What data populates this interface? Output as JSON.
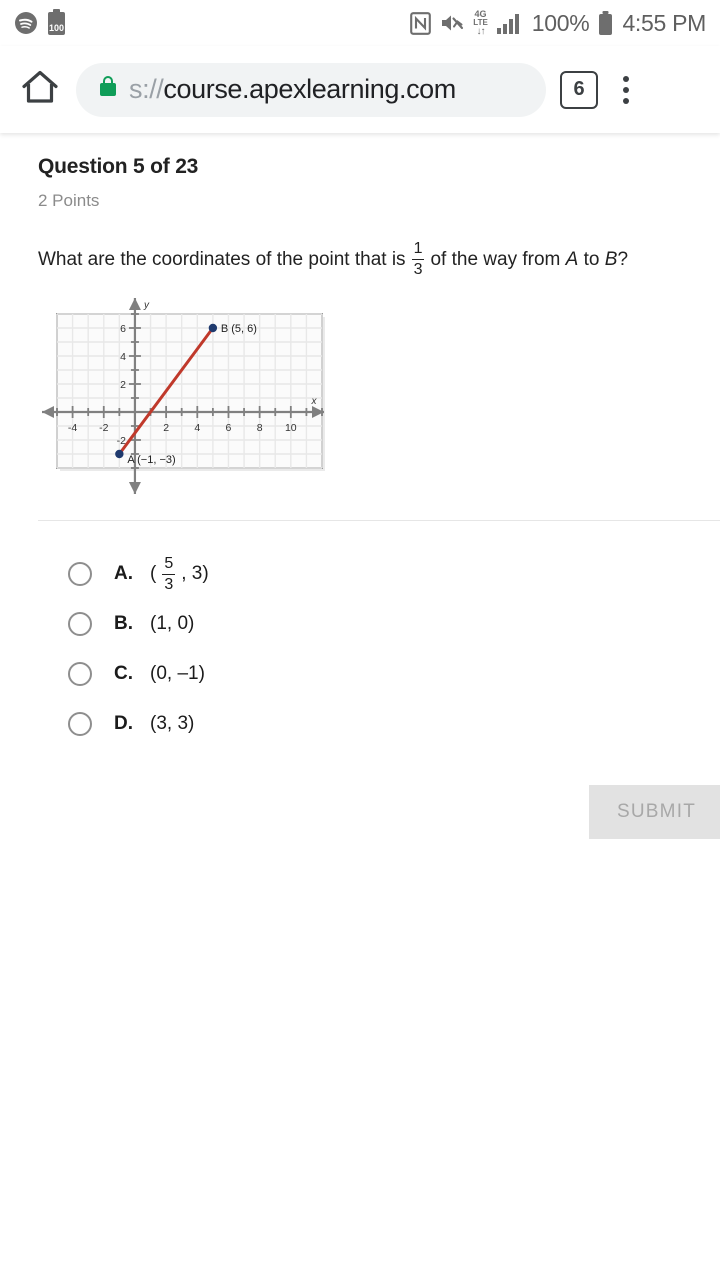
{
  "status_bar": {
    "left_icons": [
      "spotify-icon",
      "battery-saver-100-icon"
    ],
    "battery_saver_label": "100",
    "right_icons": [
      "nfc-icon",
      "volume-muted-icon",
      "lte-data-icon",
      "signal-bars-icon"
    ],
    "lte_top": "4G",
    "lte_bottom": "LTE",
    "data_arrows": "↓↑",
    "battery_percent": "100%",
    "time": "4:55 PM"
  },
  "browser": {
    "home_icon": "home-icon",
    "lock_icon": "lock-icon",
    "url_scheme": "s://",
    "url_host": "course.apexlearning.com",
    "tab_count": "6",
    "menu_icon": "overflow-menu-icon"
  },
  "question": {
    "title": "Question 5 of 23",
    "points": "2 Points",
    "prompt_part1": "What are the coordinates of the point that is",
    "fraction_numerator": "1",
    "fraction_denominator": "3",
    "prompt_part2": "of the way from",
    "point_a_letter": "A",
    "prompt_part3": "to",
    "point_b_letter": "B",
    "prompt_end": "?"
  },
  "chart_data": {
    "type": "scatter",
    "title": "",
    "xlabel": "x",
    "ylabel": "y",
    "xlim": [
      -5,
      12
    ],
    "ylim": [
      -4,
      7
    ],
    "grid": true,
    "x_ticks": [
      -4,
      -2,
      2,
      4,
      6,
      8,
      10
    ],
    "x_tick_labels": [
      "-4",
      "-2",
      "2",
      "4",
      "6",
      "8",
      "10"
    ],
    "y_ticks": [
      6,
      4,
      2,
      -2
    ],
    "y_tick_labels": [
      "6",
      "4",
      "2",
      "-2"
    ],
    "points": [
      {
        "name": "A",
        "label": "A (−1, −3)",
        "x": -1,
        "y": -3,
        "color": "#1f3a6e"
      },
      {
        "name": "B",
        "label": "B (5, 6)",
        "x": 5,
        "y": 6,
        "color": "#1f3a6e"
      }
    ],
    "segments": [
      {
        "from": "A",
        "to": "B",
        "x1": -1,
        "y1": -3,
        "x2": 5,
        "y2": 6,
        "color": "#c0392b"
      }
    ],
    "axis_color": "#808080",
    "grid_color": "#e8e8e8",
    "plot_bg": "#fbfbfb"
  },
  "answers": [
    {
      "id": "A",
      "letter": "A.",
      "type": "fraction",
      "open": "(",
      "numerator": "5",
      "denominator": "3",
      "rest": ", 3)",
      "selected": false
    },
    {
      "id": "B",
      "letter": "B.",
      "type": "plain",
      "value": "(1, 0)",
      "selected": false
    },
    {
      "id": "C",
      "letter": "C.",
      "type": "plain",
      "value": "(0, –1)",
      "selected": false
    },
    {
      "id": "D",
      "letter": "D.",
      "type": "plain",
      "value": "(3, 3)",
      "selected": false
    }
  ],
  "submit": {
    "label": "SUBMIT",
    "enabled": false
  }
}
